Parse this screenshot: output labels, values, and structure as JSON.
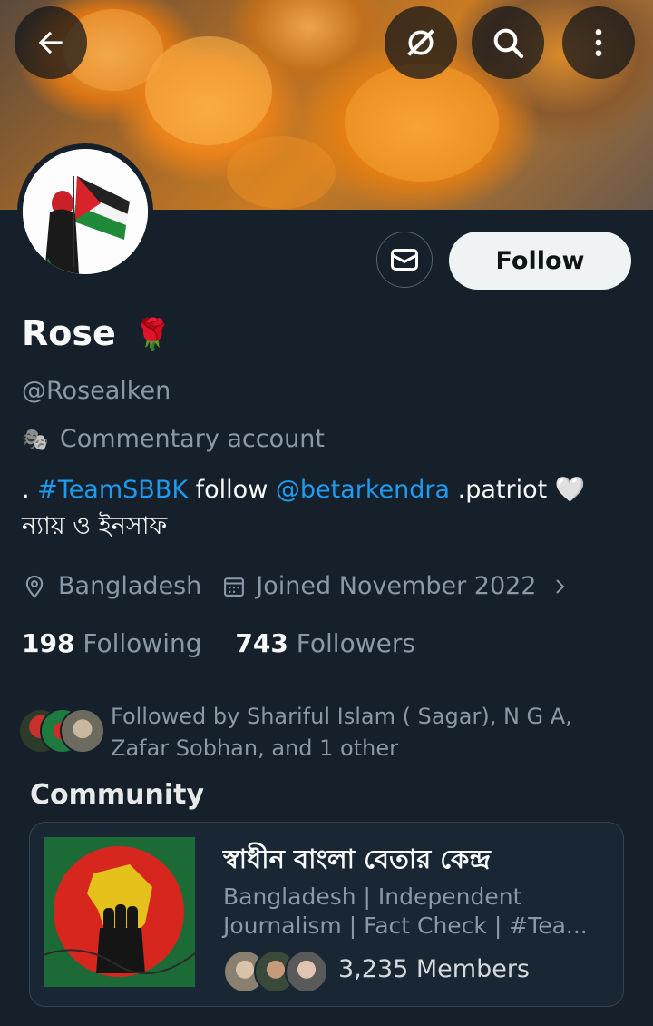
{
  "header": {
    "back_icon": "arrow-left-icon",
    "grok_icon": "grok-icon",
    "search_icon": "search-icon",
    "more_icon": "more-vertical-icon"
  },
  "profile": {
    "name": "Rose",
    "name_emoji": "🌹",
    "handle": "@Rosealken",
    "category_emoji": "🎭",
    "category": "Commentary account",
    "bio": {
      "prefix": ". ",
      "hashtag": "#TeamSBBK",
      "middle": " follow ",
      "mention": "@betarkendra",
      "suffix": " .patriot 🤍",
      "line2": "ন্যায় ও ইনসাফ"
    },
    "location": "Bangladesh",
    "joined": "Joined November 2022",
    "following_count": "198",
    "following_label": "Following",
    "followers_count": "743",
    "followers_label": "Followers",
    "followed_by": "Followed by Shariful Islam ( Sagar), N G A, Zafar Sobhan, and 1 other"
  },
  "actions": {
    "follow_label": "Follow",
    "message_icon": "envelope-icon"
  },
  "community": {
    "section_title": "Community",
    "name": "স্বাধীন বাংলা বেতার কেন্দ্র",
    "description": "Bangladesh | Independent Journalism | Fact Check | #Tea...",
    "members": "3,235 Members"
  },
  "colors": {
    "background": "#15202b",
    "link": "#1d9bf0",
    "muted": "#8b98a5",
    "follow_bg": "#eff3f4"
  }
}
